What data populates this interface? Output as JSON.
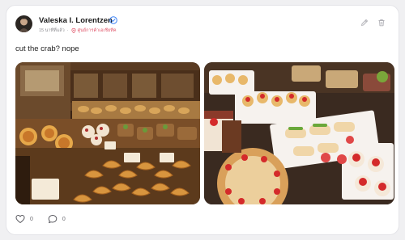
{
  "post": {
    "author": "Valeska I. Lorentzen",
    "time_ago": "15 นาทีที่แล้ว",
    "location": "ศูนย์การค้าเอเชียทีค",
    "text": "cut the crab? nope",
    "likes": "0",
    "comments": "0"
  },
  "icons": {
    "verified": "verified-badge-icon",
    "edit": "pencil-icon",
    "delete": "trash-icon",
    "location": "map-pin-icon",
    "like": "heart-icon",
    "comment": "comment-bubble-icon"
  },
  "colors": {
    "accent": "#3b82f6",
    "location_text": "#e0566a"
  }
}
